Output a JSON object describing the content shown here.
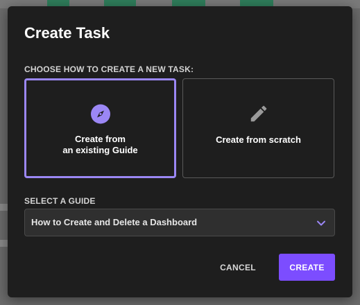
{
  "modal": {
    "title": "Create Task",
    "choose_label": "CHOOSE HOW TO CREATE A NEW TASK:",
    "options": [
      {
        "label_line1": "Create from",
        "label_line2": "an existing Guide",
        "icon": "compass-icon",
        "selected": true
      },
      {
        "label": "Create from scratch",
        "icon": "pencil-icon",
        "selected": false
      }
    ],
    "guide_label": "SELECT A GUIDE",
    "guide_select": {
      "value": "How to Create and Delete a Dashboard",
      "icon": "chevron-down-icon"
    },
    "cancel_label": "CANCEL",
    "create_label": "CREATE"
  },
  "colors": {
    "accent": "#7c4dff",
    "selected_border": "#9b87f5",
    "modal_bg": "#1e1e1e",
    "select_bg": "#2f2f2f",
    "background_green": "#2f7d5b"
  }
}
